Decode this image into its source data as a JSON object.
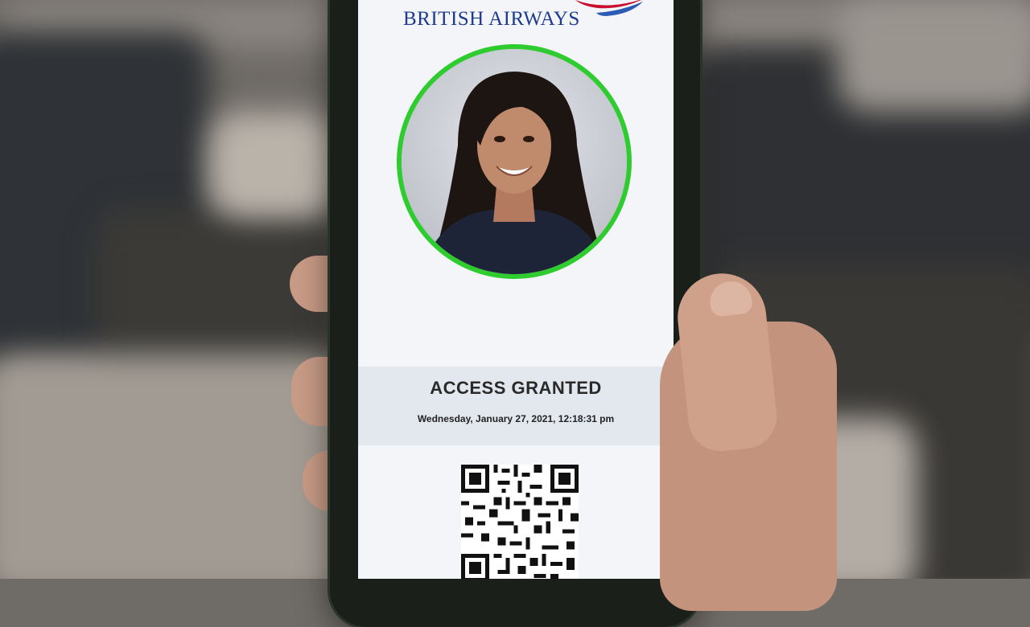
{
  "brand": {
    "name": "BRITISH AIRWAYS",
    "icon": "speedmarque-icon",
    "color": "#1d3b8f"
  },
  "status": {
    "title": "ACCESS GRANTED",
    "timestamp": "Wednesday, January 27, 2021, 12:18:31 pm",
    "ring_color": "#2ecc2e"
  },
  "qr_code": {
    "icon": "qr-code-icon"
  }
}
